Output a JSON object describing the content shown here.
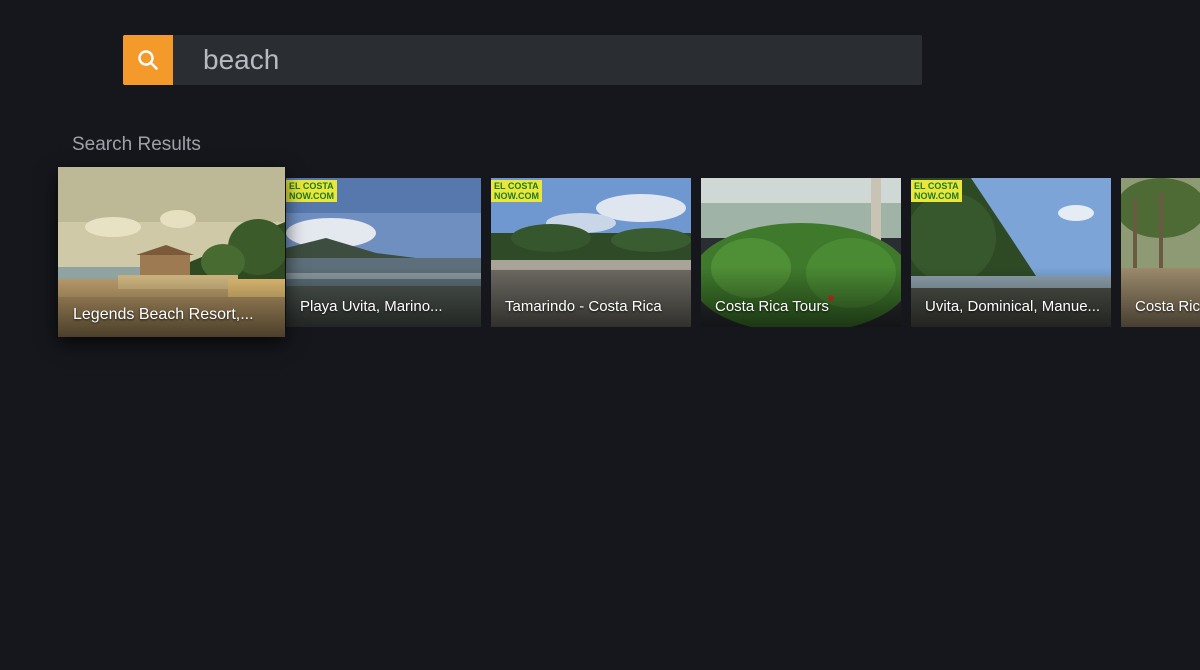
{
  "search": {
    "query": "beach",
    "button_icon": "search-icon",
    "accent_color": "#f39a2b"
  },
  "section": {
    "title": "Search Results"
  },
  "results": [
    {
      "title": "Legends Beach Resort, Bocas del Toro",
      "display": "Legends Beach Resort,..."
    },
    {
      "title": "Playa Uvita, Marino Ballena",
      "display": "Playa Uvita, Marino..."
    },
    {
      "title": "Tamarindo - Costa Rica",
      "display": "Tamarindo - Costa Rica"
    },
    {
      "title": "Costa Rica Tours",
      "display": "Costa Rica Tours"
    },
    {
      "title": "Uvita, Dominical, Manuel Antonio",
      "display": "Uvita, Dominical, Manue..."
    },
    {
      "title": "Costa Rica",
      "display": "Costa Ric"
    }
  ]
}
